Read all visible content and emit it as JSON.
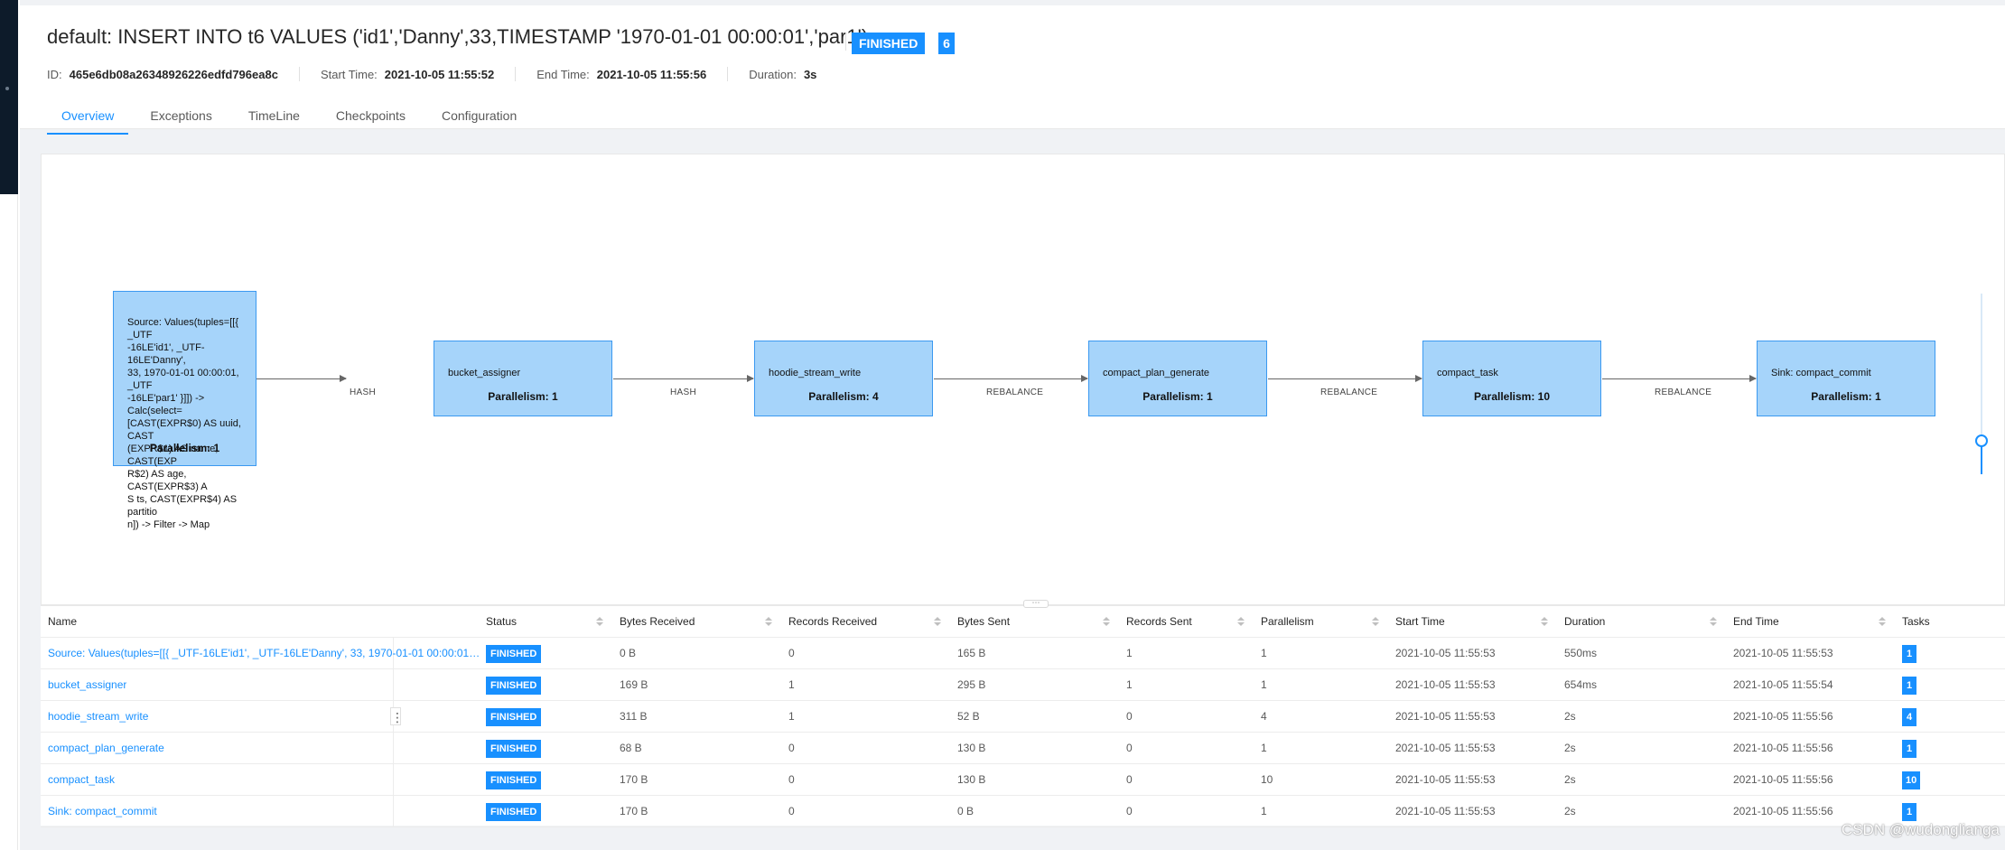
{
  "job": {
    "title": "default: INSERT INTO t6 VALUES ('id1','Danny',33,TIMESTAMP '1970-01-01 00:00:01','par1')",
    "status": "FINISHED",
    "task_count": "6",
    "id_label": "ID:",
    "id": "465e6db08a26348926226edfd796ea8c",
    "start_label": "Start Time:",
    "start": "2021-10-05 11:55:52",
    "end_label": "End Time:",
    "end": "2021-10-05 11:55:56",
    "duration_label": "Duration:",
    "duration": "3s"
  },
  "tabs": [
    "Overview",
    "Exceptions",
    "TimeLine",
    "Checkpoints",
    "Configuration"
  ],
  "graph": {
    "nodes": [
      {
        "lines": [
          "Source: Values(tuples=[[{ _UTF",
          "-16LE'id1', _UTF-16LE'Danny',",
          "33, 1970-01-01 00:00:01, _UTF",
          "-16LE'par1' }]]) -> Calc(select=",
          "[CAST(EXPR$0) AS uuid, CAST",
          "(EXPR$1) AS name, CAST(EXP",
          "R$2) AS age, CAST(EXPR$3) A",
          "S ts, CAST(EXPR$4) AS partitio",
          "n]) -> Filter -> Map"
        ],
        "parallelism": "Parallelism: 1"
      },
      {
        "lines": [
          "bucket_assigner"
        ],
        "parallelism": "Parallelism: 1"
      },
      {
        "lines": [
          "hoodie_stream_write"
        ],
        "parallelism": "Parallelism: 4"
      },
      {
        "lines": [
          "compact_plan_generate"
        ],
        "parallelism": "Parallelism: 1"
      },
      {
        "lines": [
          "compact_task"
        ],
        "parallelism": "Parallelism: 10"
      },
      {
        "lines": [
          "Sink: compact_commit"
        ],
        "parallelism": "Parallelism: 1"
      }
    ],
    "edges": [
      "HASH",
      "HASH",
      "REBALANCE",
      "REBALANCE",
      "REBALANCE"
    ]
  },
  "table": {
    "columns": [
      "Name",
      "Status",
      "Bytes Received",
      "Records Received",
      "Bytes Sent",
      "Records Sent",
      "Parallelism",
      "Start Time",
      "Duration",
      "End Time",
      "Tasks"
    ],
    "rows": [
      {
        "name": "Source: Values(tuples=[[{ _UTF-16LE'id1', _UTF-16LE'Danny', 33, 1970-01-01 00:00:01, _U...",
        "status": "FINISHED",
        "bytes_received": "0 B",
        "records_received": "0",
        "bytes_sent": "165 B",
        "records_sent": "1",
        "parallelism": "1",
        "start_time": "2021-10-05 11:55:53",
        "duration": "550ms",
        "end_time": "2021-10-05 11:55:53",
        "tasks": "1"
      },
      {
        "name": "bucket_assigner",
        "status": "FINISHED",
        "bytes_received": "169 B",
        "records_received": "1",
        "bytes_sent": "295 B",
        "records_sent": "1",
        "parallelism": "1",
        "start_time": "2021-10-05 11:55:53",
        "duration": "654ms",
        "end_time": "2021-10-05 11:55:54",
        "tasks": "1"
      },
      {
        "name": "hoodie_stream_write",
        "status": "FINISHED",
        "bytes_received": "311 B",
        "records_received": "1",
        "bytes_sent": "52 B",
        "records_sent": "0",
        "parallelism": "4",
        "start_time": "2021-10-05 11:55:53",
        "duration": "2s",
        "end_time": "2021-10-05 11:55:56",
        "tasks": "4"
      },
      {
        "name": "compact_plan_generate",
        "status": "FINISHED",
        "bytes_received": "68 B",
        "records_received": "0",
        "bytes_sent": "130 B",
        "records_sent": "0",
        "parallelism": "1",
        "start_time": "2021-10-05 11:55:53",
        "duration": "2s",
        "end_time": "2021-10-05 11:55:56",
        "tasks": "1"
      },
      {
        "name": "compact_task",
        "status": "FINISHED",
        "bytes_received": "170 B",
        "records_received": "0",
        "bytes_sent": "130 B",
        "records_sent": "0",
        "parallelism": "10",
        "start_time": "2021-10-05 11:55:53",
        "duration": "2s",
        "end_time": "2021-10-05 11:55:56",
        "tasks": "10"
      },
      {
        "name": "Sink: compact_commit",
        "status": "FINISHED",
        "bytes_received": "170 B",
        "records_received": "0",
        "bytes_sent": "0 B",
        "records_sent": "0",
        "parallelism": "1",
        "start_time": "2021-10-05 11:55:53",
        "duration": "2s",
        "end_time": "2021-10-05 11:55:56",
        "tasks": "1"
      }
    ]
  },
  "watermark": "CSDN @wudonglianga",
  "colors": {
    "accent": "#1890ff",
    "node_fill": "#a6d4fa",
    "node_border": "#3b99f0"
  },
  "icons": {
    "more": "vertical-ellipsis-icon",
    "drag": "horizontal-ellipsis-icon",
    "sort": "sort-icon"
  }
}
